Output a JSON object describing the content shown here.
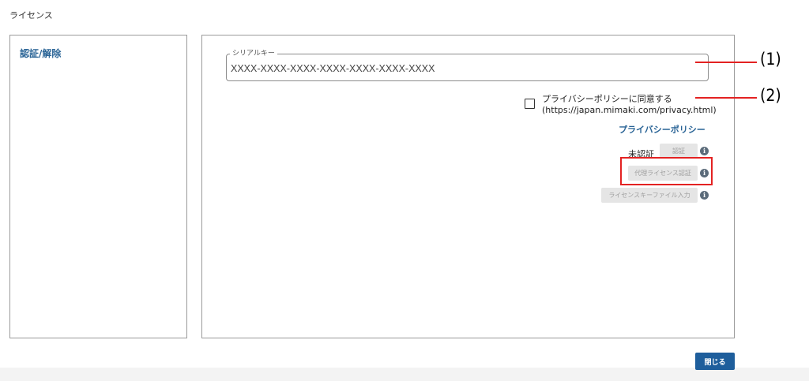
{
  "window": {
    "title": "ライセンス"
  },
  "sidebar": {
    "items": [
      {
        "label": "認証/解除"
      }
    ]
  },
  "serial_key": {
    "label": "シリアルキー",
    "placeholder": "XXXX-XXXX-XXXX-XXXX-XXXX-XXXX-XXXX"
  },
  "privacy": {
    "checkbox_label": "プライバシーポリシーに同意する",
    "url_text": "(https://japan.mimaki.com/privacy.html)",
    "checked": false,
    "link_label": "プライバシーポリシー"
  },
  "activation": {
    "status": "未認証",
    "authenticate_label": "認証",
    "proxy_label": "代理ライセンス認証",
    "keyfile_label": "ライセンスキーファイル入力",
    "info_glyph": "i"
  },
  "annotations": {
    "callout_1": "(1)",
    "callout_2": "(2)",
    "accent_color": "#e32222"
  },
  "footer": {
    "close_label": "閉じる"
  },
  "colors": {
    "link": "#2a6496",
    "primary_button": "#1e5e9c",
    "disabled_button": "#e5e5e5",
    "info_icon": "#5b6b7a"
  }
}
